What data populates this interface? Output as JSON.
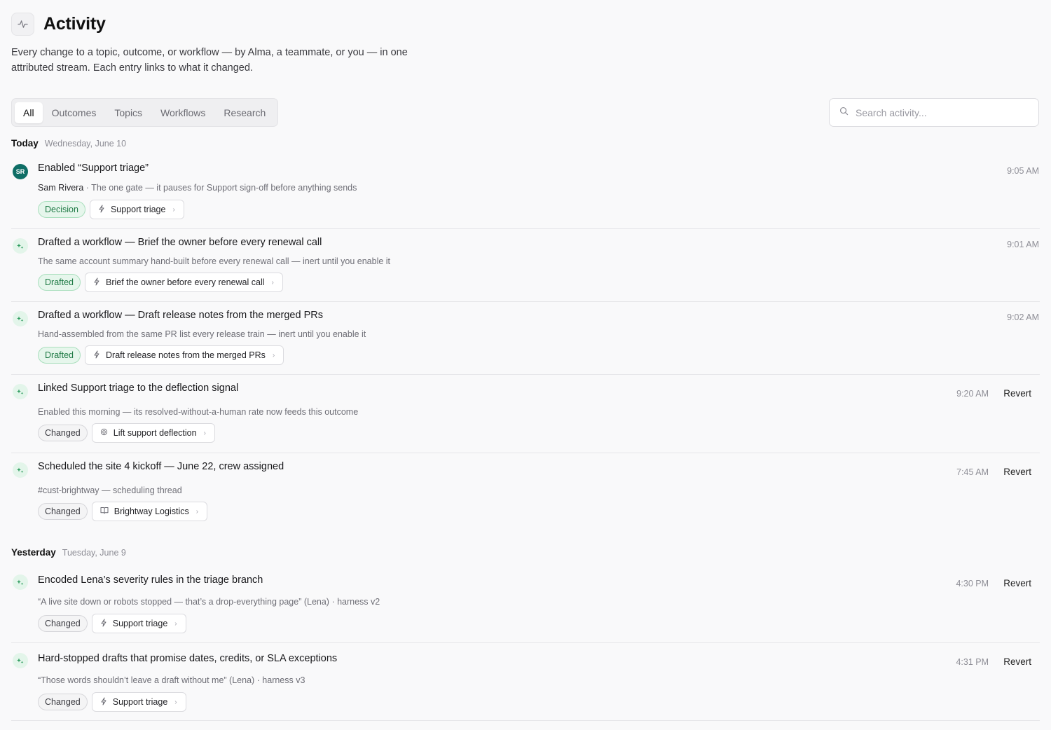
{
  "header": {
    "title": "Activity",
    "subtitle": "Every change to a topic, outcome, or workflow — by Alma, a teammate, or you — in one attributed stream. Each entry links to what it changed.",
    "icon": "activity-pulse-icon"
  },
  "tabs": [
    {
      "label": "All",
      "active": true
    },
    {
      "label": "Outcomes",
      "active": false
    },
    {
      "label": "Topics",
      "active": false
    },
    {
      "label": "Workflows",
      "active": false
    },
    {
      "label": "Research",
      "active": false
    }
  ],
  "search": {
    "placeholder": "Search activity..."
  },
  "sections": [
    {
      "label": "Today",
      "date": "Wednesday, June 10",
      "entries": [
        {
          "avatar": "SR",
          "title": "Enabled “Support triage”",
          "author": "Sam Rivera",
          "meta": " · The one gate — it pauses for Support sign-off before anything sends",
          "status": "Decision",
          "status_style": "green",
          "link_icon": "workflow-bolt-icon",
          "link_label": "Support triage",
          "time": "9:05 AM",
          "revert": ""
        },
        {
          "avatar": "",
          "title": "Drafted a workflow — Brief the owner before every renewal call",
          "author": "",
          "meta": "The same account summary hand-built before every renewal call — inert until you enable it",
          "status": "Drafted",
          "status_style": "green",
          "link_icon": "workflow-bolt-icon",
          "link_label": "Brief the owner before every renewal call",
          "time": "9:01 AM",
          "revert": ""
        },
        {
          "avatar": "",
          "title": "Drafted a workflow — Draft release notes from the merged PRs",
          "author": "",
          "meta": "Hand-assembled from the same PR list every release train — inert until you enable it",
          "status": "Drafted",
          "status_style": "green",
          "link_icon": "workflow-bolt-icon",
          "link_label": "Draft release notes from the merged PRs",
          "time": "9:02 AM",
          "revert": ""
        },
        {
          "avatar": "",
          "title": "Linked Support triage to the deflection signal",
          "author": "",
          "meta": "Enabled this morning — its resolved-without-a-human rate now feeds this outcome",
          "status": "Changed",
          "status_style": "gray",
          "link_icon": "target-icon",
          "link_label": "Lift support deflection",
          "time": "9:20 AM",
          "revert": "Revert"
        },
        {
          "avatar": "",
          "title": "Scheduled the site 4 kickoff — June 22, crew assigned",
          "author": "",
          "meta": "#cust-brightway — scheduling thread",
          "status": "Changed",
          "status_style": "gray",
          "link_icon": "book-icon",
          "link_label": "Brightway Logistics",
          "time": "7:45 AM",
          "revert": "Revert"
        }
      ]
    },
    {
      "label": "Yesterday",
      "date": "Tuesday, June 9",
      "entries": [
        {
          "avatar": "",
          "title": "Encoded Lena’s severity rules in the triage branch",
          "author": "",
          "meta": "“A live site down or robots stopped — that’s a drop-everything page” (Lena) · harness v2",
          "status": "Changed",
          "status_style": "gray",
          "link_icon": "workflow-bolt-icon",
          "link_label": "Support triage",
          "time": "4:30 PM",
          "revert": "Revert"
        },
        {
          "avatar": "",
          "title": "Hard-stopped drafts that promise dates, credits, or SLA exceptions",
          "author": "",
          "meta": "“Those words shouldn’t leave a draft without me” (Lena) · harness v3",
          "status": "Changed",
          "status_style": "gray",
          "link_icon": "workflow-bolt-icon",
          "link_label": "Support triage",
          "time": "4:31 PM",
          "revert": "Revert"
        }
      ]
    }
  ]
}
